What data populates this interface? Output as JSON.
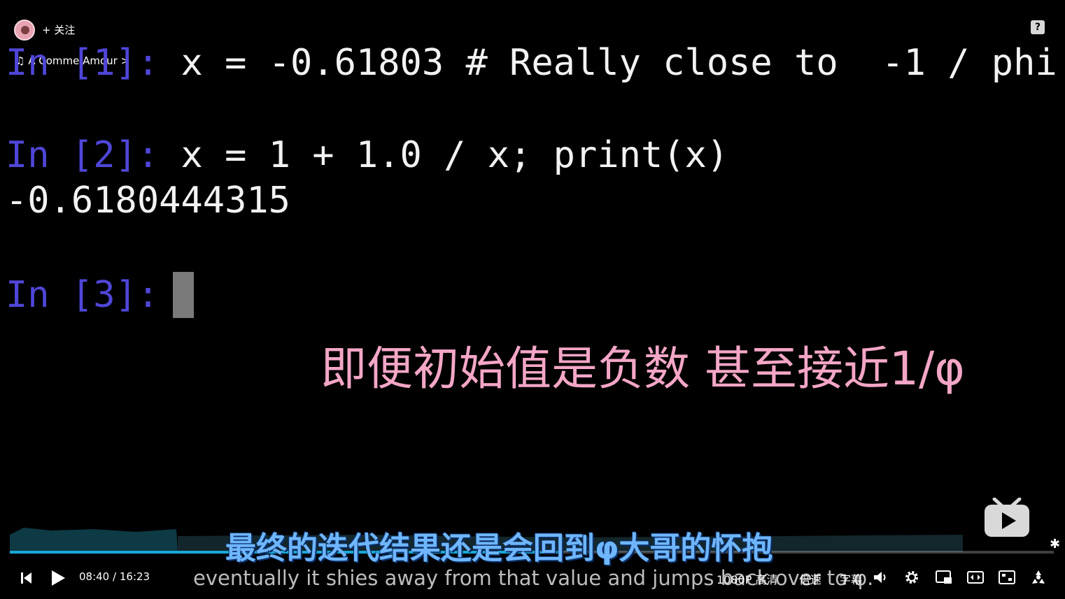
{
  "uploader": {
    "follow_label": "+ 关注"
  },
  "music": {
    "label": "♫ A Comme Amour >"
  },
  "help": {
    "label": "?"
  },
  "terminal": {
    "lines": [
      {
        "prompt": "In [1]:",
        "code": " x = -0.61803 # Really close to  -1 / phi"
      },
      {
        "prompt": "In [2]:",
        "code": " x = 1 + 1.0 / x; print(x)"
      },
      {
        "output": "-0.6180444315"
      },
      {
        "prompt": "In [3]:",
        "code": ""
      }
    ]
  },
  "overlay_caption": "即便初始值是负数 甚至接近1/φ",
  "subtitles": {
    "chinese": "最终的迭代结果还是会回到φ大哥的怀抱",
    "english": "eventually it shies away from that value and jumps back over to φ."
  },
  "controls": {
    "current_time": "08:40",
    "separator": "/",
    "duration": "16:23",
    "quality": "1080P 高清",
    "speed": "倍速",
    "subtitle_toggle": "字幕",
    "progress_fraction": 0.529
  },
  "colors": {
    "prompt": "#4f46d8",
    "accent_progress": "#1aa8d8",
    "caption_pink": "#f4a6c6",
    "subtitle_blue": "#6fb6ff"
  }
}
